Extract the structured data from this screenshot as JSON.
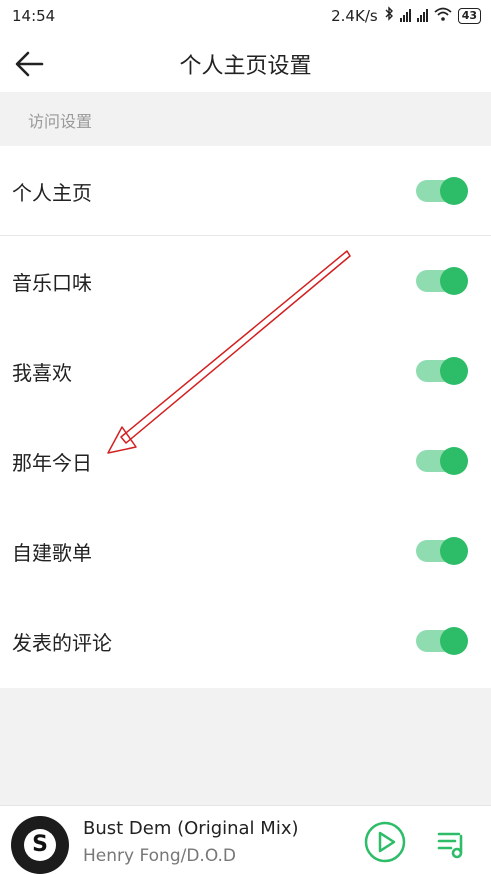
{
  "status_bar": {
    "time": "14:54",
    "network_speed": "2.4K/s",
    "battery": "43"
  },
  "header": {
    "title": "个人主页设置",
    "back_icon": "arrow-left-icon"
  },
  "section": {
    "label": "访问设置"
  },
  "settings": [
    {
      "label": "个人主页",
      "enabled": true
    },
    {
      "label": "音乐口味",
      "enabled": true
    },
    {
      "label": "我喜欢",
      "enabled": true
    },
    {
      "label": "那年今日",
      "enabled": true
    },
    {
      "label": "自建歌单",
      "enabled": true
    },
    {
      "label": "发表的评论",
      "enabled": true
    }
  ],
  "player": {
    "song_title": "Bust Dem (Original Mix)",
    "artist": "Henry Fong/D.O.D",
    "album_logo": "S"
  },
  "colors": {
    "toggle_on_track": "#8fdcb1",
    "toggle_on_knob": "#2dbd68",
    "annotation_arrow": "#d32020"
  }
}
